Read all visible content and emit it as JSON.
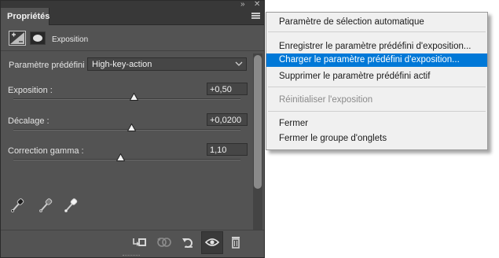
{
  "panel": {
    "tab_label": "Propriétés",
    "adjustment_title": "Exposition",
    "preset": {
      "label": "Paramètre prédéfini :",
      "value": "High-key-action"
    },
    "params": [
      {
        "label": "Exposition :",
        "value": "+0,50",
        "slider_fraction": 0.53
      },
      {
        "label": "Décalage :",
        "value": "+0,0200",
        "slider_fraction": 0.52
      },
      {
        "label": "Correction gamma :",
        "value": "1,10",
        "slider_fraction": 0.47
      }
    ],
    "icons": {
      "panel_menu": "menu-lines-icon",
      "collapse": "double-chevron-icon",
      "close": "close-icon",
      "exposure": "exposure-icon",
      "mask": "mask-icon",
      "pipettes": [
        "black-point-eyedropper-icon",
        "gray-point-eyedropper-icon",
        "white-point-eyedropper-icon"
      ],
      "bottom": [
        "clip-to-layer-icon",
        "view-previous-state-icon",
        "reset-icon",
        "visibility-icon",
        "trash-icon"
      ]
    }
  },
  "menu": {
    "items": [
      "Paramètre de sélection automatique",
      "Enregistrer le paramètre prédéfini d'exposition...",
      "Charger le paramètre prédéfini d'exposition...",
      "Supprimer le paramètre prédéfini actif",
      "Réinitialiser l'exposition",
      "Fermer",
      "Fermer le groupe d'onglets"
    ],
    "highlighted_index": 2,
    "disabled_index": 4,
    "highlight_color": "#0078d7"
  }
}
